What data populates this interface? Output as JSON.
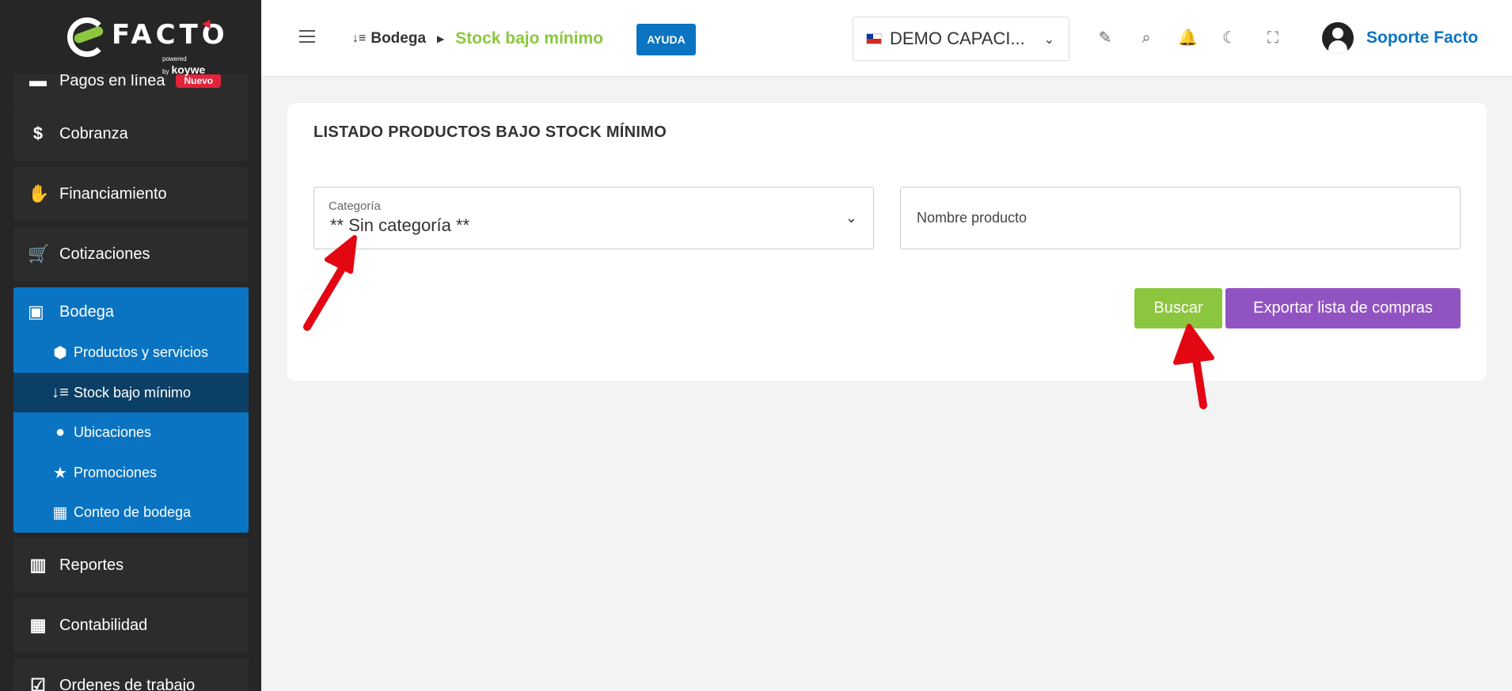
{
  "app": {
    "logo_text": "FACTO",
    "logo_powered": "powered by",
    "logo_brand": "koywe"
  },
  "sidebar": {
    "partial_top": {
      "label": "Pagos en línea",
      "badge": "Nuevo"
    },
    "items_top": [
      {
        "label": "Cobranza",
        "icon": "dollar-icon"
      },
      {
        "label": "Financiamiento",
        "icon": "hand-money-icon"
      },
      {
        "label": "Cotizaciones",
        "icon": "cart-icon"
      }
    ],
    "bodega": {
      "label": "Bodega",
      "icon": "boxes-icon",
      "subitems": [
        {
          "label": "Productos y servicios",
          "icon": "box-icon"
        },
        {
          "label": "Stock bajo mínimo",
          "icon": "sort-down-icon",
          "active": true
        },
        {
          "label": "Ubicaciones",
          "icon": "map-pin-icon"
        },
        {
          "label": "Promociones",
          "icon": "star-icon"
        },
        {
          "label": "Conteo de bodega",
          "icon": "calculator-icon"
        }
      ]
    },
    "items_bottom": [
      {
        "label": "Reportes",
        "icon": "bar-chart-icon"
      },
      {
        "label": "Contabilidad",
        "icon": "calculator-icon"
      },
      {
        "label": "Ordenes de trabajo",
        "icon": "checklist-icon"
      }
    ]
  },
  "header": {
    "breadcrumb_parent": "Bodega",
    "breadcrumb_current": "Stock bajo mínimo",
    "help_label": "AYUDA",
    "company_selector": "DEMO CAPACI...",
    "user_name": "Soporte Facto"
  },
  "main": {
    "title": "LISTADO PRODUCTOS BAJO STOCK MÍNIMO",
    "category_label": "Categoría",
    "category_value": "** Sin categoría **",
    "product_placeholder": "Nombre producto",
    "search_button": "Buscar",
    "export_button": "Exportar lista de compras"
  },
  "colors": {
    "accent_blue": "#0a74c2",
    "accent_green": "#8cc63f",
    "accent_purple": "#9253c2",
    "sidebar_bg": "#262626",
    "annotation_red": "#e30613"
  }
}
